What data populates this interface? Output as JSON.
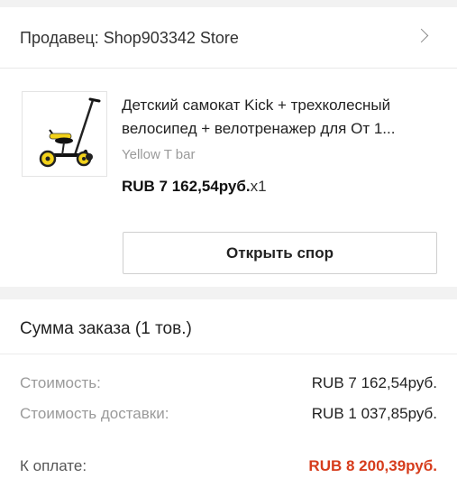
{
  "seller": {
    "label": "Продавец: Shop903342 Store"
  },
  "product": {
    "title_line1": "Детский самокат Kick + трехколесный",
    "title_line2": "велосипед + велотренажер для От 1...",
    "variant": "Yellow T bar",
    "price": "RUB 7 162,54руб.",
    "quantity": "x1",
    "image_alt": "kick scooter"
  },
  "actions": {
    "open_dispute": "Открыть спор"
  },
  "summary": {
    "title": "Сумма заказа (1 тов.)",
    "cost_label": "Стоимость:",
    "cost_value": "RUB 7 162,54руб.",
    "shipping_label": "Стоимость доставки:",
    "shipping_value": "RUB 1 037,85руб.",
    "total_label": "К оплате:",
    "total_value": "RUB 8 200,39руб."
  },
  "colors": {
    "accent_total": "#d63c1c",
    "scooter_yellow": "#f2d21b"
  },
  "icons": {
    "seller_chevron": "chevron-right-icon"
  }
}
